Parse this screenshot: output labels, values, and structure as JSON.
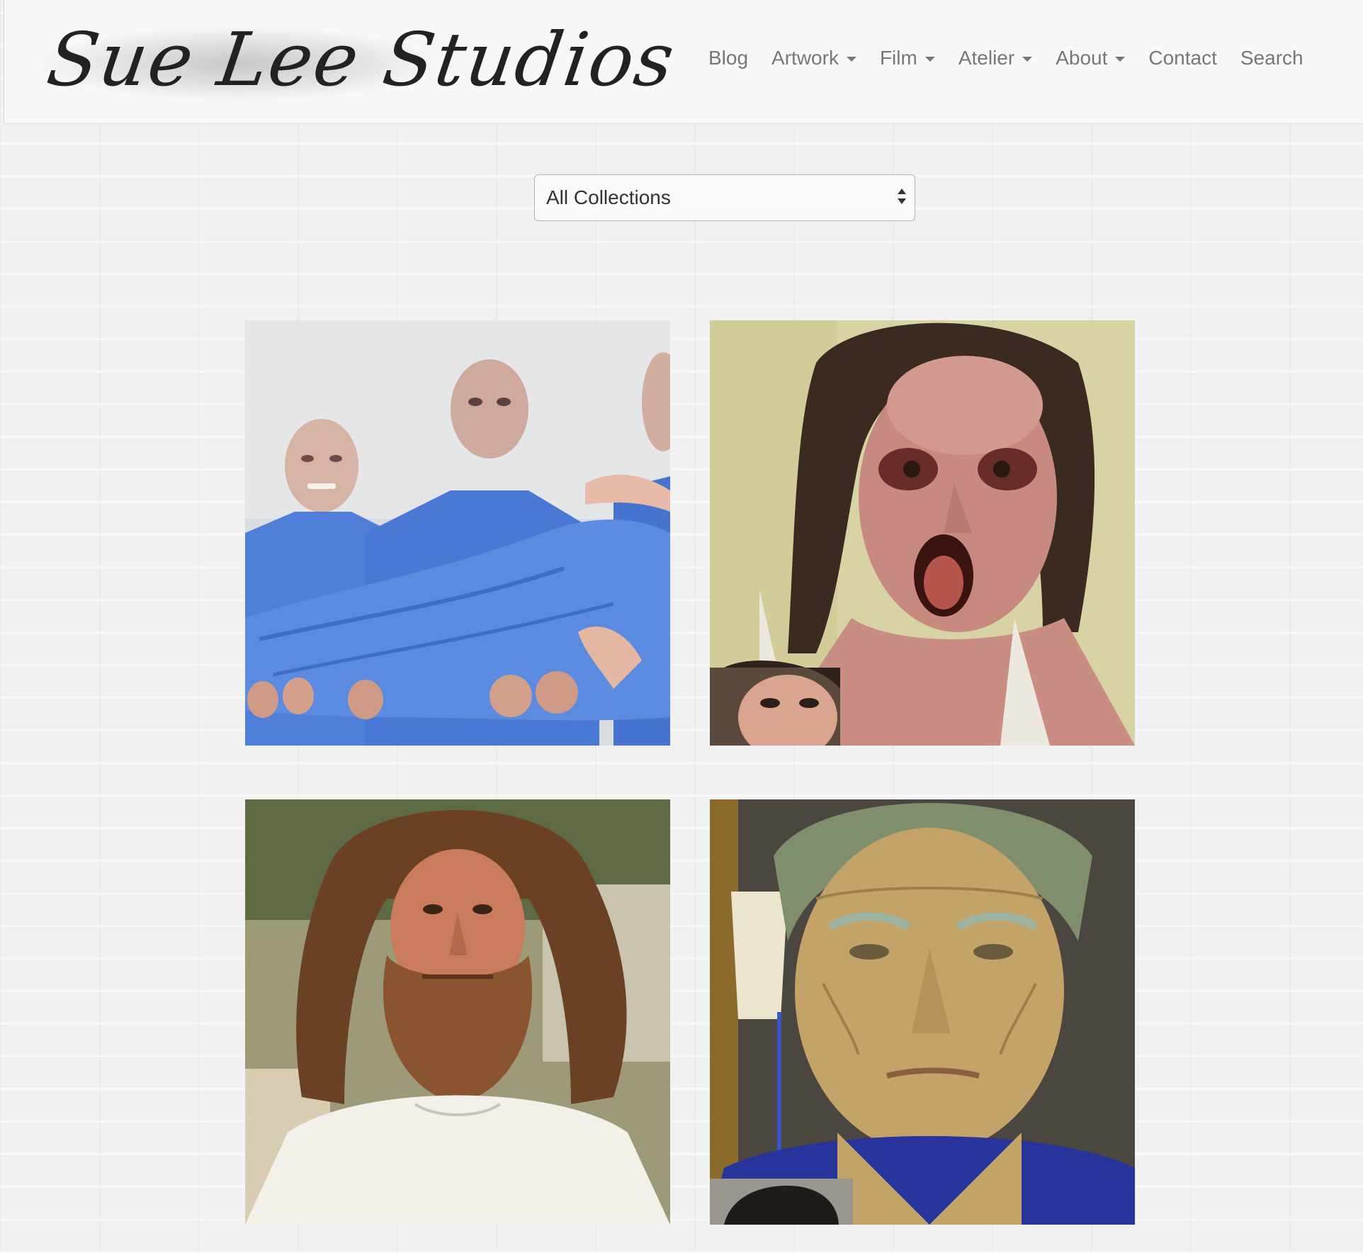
{
  "site": {
    "logo_text": "Sue Lee Studios"
  },
  "nav": {
    "items": [
      {
        "label": "Blog",
        "dropdown": false
      },
      {
        "label": "Artwork",
        "dropdown": true
      },
      {
        "label": "Film",
        "dropdown": true
      },
      {
        "label": "Atelier",
        "dropdown": true
      },
      {
        "label": "About",
        "dropdown": true
      },
      {
        "label": "Contact",
        "dropdown": false
      },
      {
        "label": "Search",
        "dropdown": false
      }
    ]
  },
  "filter": {
    "selected": "All Collections"
  },
  "colors": {
    "nav_text": "#777777",
    "page_background": "#f1f1f1",
    "header_background": "#f8f8f8"
  }
}
